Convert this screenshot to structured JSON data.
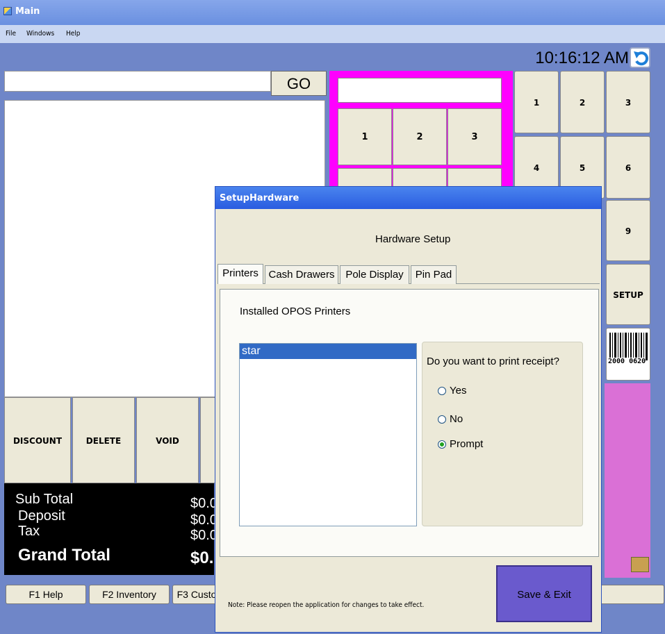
{
  "window": {
    "title": "Main"
  },
  "menu": [
    "File",
    "Windows",
    "Help"
  ],
  "header": {
    "time": "10:16:12 AM"
  },
  "search": {
    "value": "",
    "go_label": "GO"
  },
  "mag_keypad": {
    "input_value": "",
    "keys": [
      "1",
      "2",
      "3"
    ]
  },
  "right_keypad": {
    "keys": [
      "1",
      "2",
      "3",
      "4",
      "5",
      "6",
      "9"
    ],
    "setup_label": "SETUP",
    "barcode_text": "2000 0620"
  },
  "actions": [
    "DISCOUNT",
    "DELETE",
    "VOID"
  ],
  "totals": {
    "sub_total_label": "Sub Total",
    "sub_total_value": "$0.0",
    "deposit_label": "Deposit",
    "deposit_value": "$0.0",
    "tax_label": "Tax",
    "tax_value": "$0.0",
    "grand_total_label": "Grand Total",
    "grand_total_value": "$0."
  },
  "fkeys": [
    "F1 Help",
    "F2 Inventory",
    "F3 Custo"
  ],
  "dialog": {
    "title": "SetupHardware",
    "heading": "Hardware Setup",
    "tabs": [
      "Printers",
      "Cash Drawers",
      "Pole Display",
      "Pin Pad"
    ],
    "active_tab": "Printers",
    "section_label": "Installed OPOS Printers",
    "printers": [
      "star"
    ],
    "selected_printer": "star",
    "receipt_question": "Do you want to print receipt?",
    "receipt_options": [
      "Yes",
      "No",
      "Prompt"
    ],
    "selected_option": "Prompt",
    "note": "Note: Please reopen the application for changes to take effect.",
    "save_label": "Save & Exit"
  },
  "colors": {
    "magenta": "#ff00ff",
    "pink_panel": "#da70d6",
    "save_button": "#6a5acd",
    "selection": "#316ac5",
    "background": "#6f86c8"
  }
}
